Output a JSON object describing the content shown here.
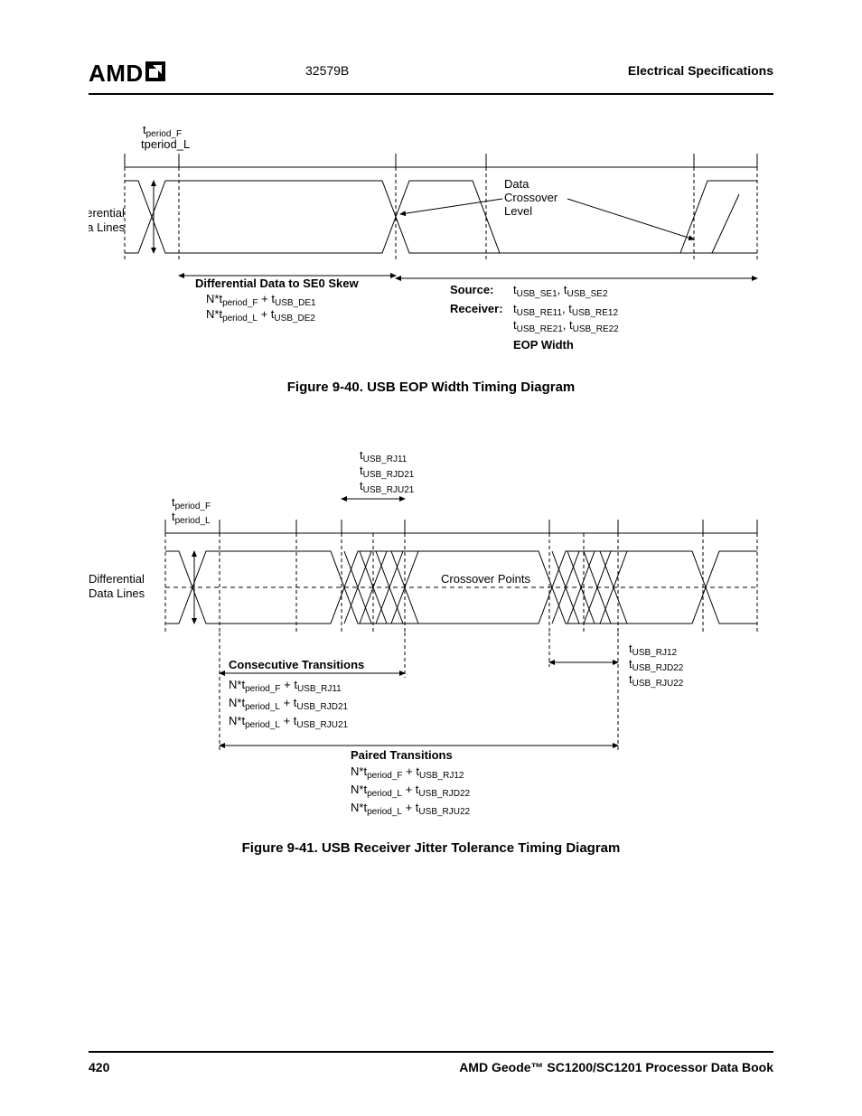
{
  "header": {
    "docnum": "32579B",
    "section": "Electrical Specifications",
    "logo": "AMD"
  },
  "footer": {
    "page": "420",
    "title": "AMD Geode™ SC1200/SC1201 Processor Data Book"
  },
  "fig40": {
    "caption": "Figure 9-40.  USB EOP Width Timing Diagram",
    "period1": "period_F",
    "period2": "tperiod_L",
    "diff": "Differential",
    "data": "Data Lines",
    "dcl1": "Data",
    "dcl2": "Crossover",
    "dcl3": "Level",
    "skew": "Differential Data to SE0 Skew",
    "skew_f1": "N*t",
    "skew_f1s": "period_F",
    "skew_f1b": " + t",
    "skew_f1bs": "USB_DE1",
    "skew_f2": "N*t",
    "skew_f2s": "period_L",
    "skew_f2b": " + t",
    "skew_f2bs": "USB_DE2",
    "src": "Source:",
    "src_t1": "t",
    "src_t1s": "USB_SE1",
    "src_t2": ", t",
    "src_t2s": "USB_SE2",
    "rcv": "Receiver:",
    "rcv_t1": "t",
    "rcv_t1s": "USB_RE11",
    "rcv_t2": ", t",
    "rcv_t2s": "USB_RE12",
    "rcv_t3": "t",
    "rcv_t3s": "USB_RE21",
    "rcv_t4": ", t",
    "rcv_t4s": "USB_RE22",
    "eop": "EOP Width"
  },
  "fig41": {
    "caption": "Figure 9-41.  USB Receiver Jitter Tolerance Timing Diagram",
    "top1": "t",
    "top1s": "USB_RJ11",
    "top2": "t",
    "top2s": "USB_RJD21",
    "top3": "t",
    "top3s": "USB_RJU21",
    "p1": "t",
    "p1s": "period_F",
    "p2": "t",
    "p2s": "period_L",
    "diff": "Differential",
    "data": "Data Lines",
    "xp": "Crossover Points",
    "right1": "t",
    "right1s": "USB_RJ12",
    "right2": "t",
    "right2s": "USB_RJD22",
    "right3": "t",
    "right3s": "USB_RJU22",
    "ct": "Consecutive Transitions",
    "ctf1": "N*t",
    "ctf1s": "period_F",
    "ctf1b": " + t",
    "ctf1bs": "USB_RJ11",
    "ctf2": "N*t",
    "ctf2s": "period_L",
    "ctf2b": " + t",
    "ctf2bs": "USB_RJD21",
    "ctf3": "N*t",
    "ctf3s": "period_L",
    "ctf3b": " + t",
    "ctf3bs": "USB_RJU21",
    "pt": "Paired Transitions",
    "ptf1": "N*t",
    "ptf1s": "period_F",
    "ptf1b": " + t",
    "ptf1bs": "USB_RJ12",
    "ptf2": "N*t",
    "ptf2s": "period_L",
    "ptf2b": " + t",
    "ptf2bs": "USB_RJD22",
    "ptf3": "N*t",
    "ptf3s": "period_L",
    "ptf3b": " + t",
    "ptf3bs": "USB_RJU22"
  }
}
